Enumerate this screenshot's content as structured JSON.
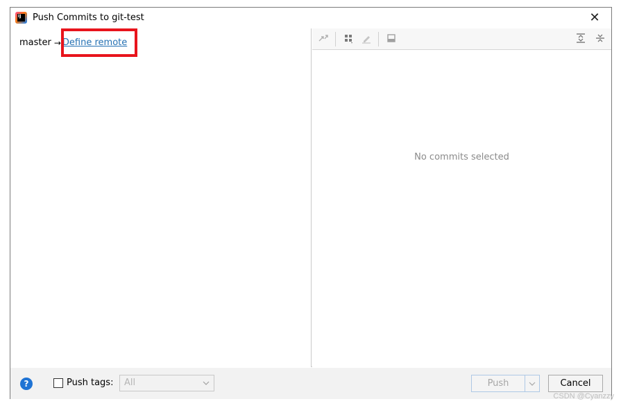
{
  "window": {
    "title": "Push Commits to git-test",
    "close_glyph": "✕"
  },
  "left": {
    "branch": "master",
    "arrow": "→",
    "define_remote": "Define remote"
  },
  "toolbar": {
    "icons": [
      "pull-arrows-icon",
      "group-grid-icon",
      "edit-pencil-icon",
      "panel-icon",
      "expand-all-icon",
      "collapse-all-icon"
    ]
  },
  "right": {
    "empty_text": "No commits selected"
  },
  "footer": {
    "help_glyph": "?",
    "push_tags_label": "Push tags:",
    "tags_value": "All",
    "push_label": "Push",
    "cancel_label": "Cancel"
  },
  "colors": {
    "link": "#2470b3",
    "highlight": "#e8141c",
    "help": "#1f73d4"
  },
  "watermark": "CSDN @Cyanzzy"
}
